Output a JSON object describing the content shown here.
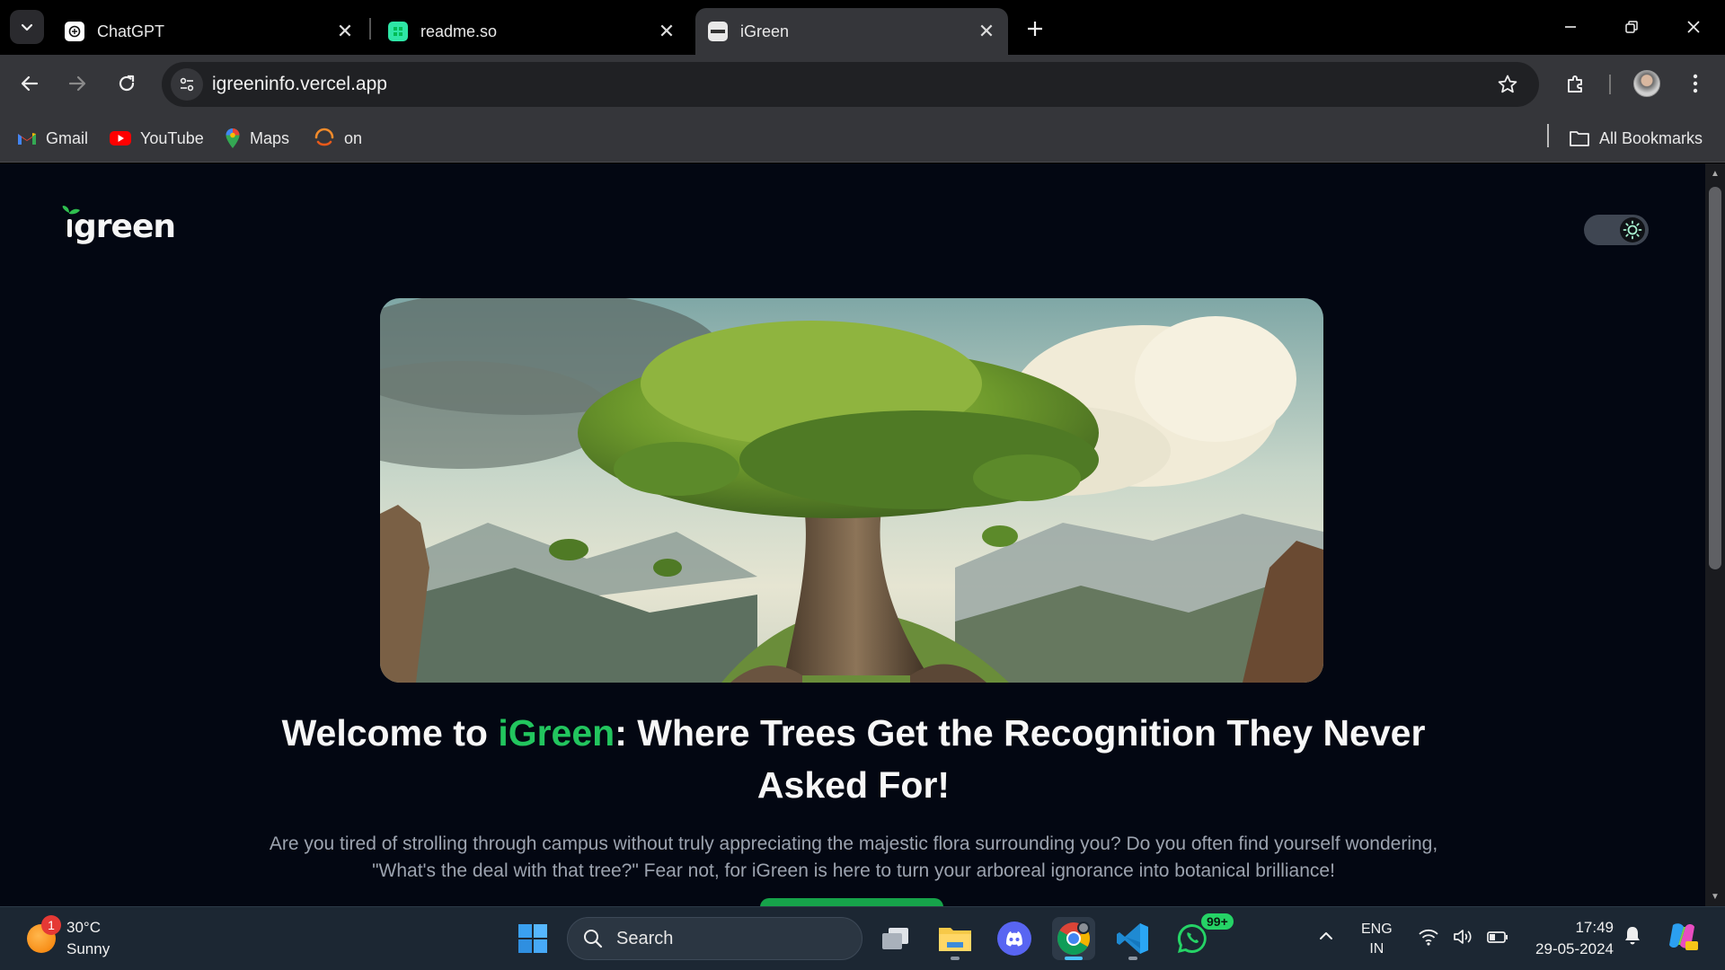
{
  "browser": {
    "tabs": [
      {
        "title": "ChatGPT",
        "active": false
      },
      {
        "title": "readme.so",
        "active": false
      },
      {
        "title": "iGreen",
        "active": true
      }
    ],
    "url": "igreeninfo.vercel.app",
    "bookmarks": [
      {
        "label": "Gmail",
        "icon": "gmail-icon"
      },
      {
        "label": "YouTube",
        "icon": "youtube-icon"
      },
      {
        "label": "Maps",
        "icon": "maps-icon"
      },
      {
        "label": "on",
        "icon": "orange-arc-icon"
      }
    ],
    "all_bookmarks_label": "All Bookmarks"
  },
  "page": {
    "logo_text": "green",
    "headline_prefix": "Welcome to ",
    "headline_brand": "iGreen",
    "headline_suffix": ": Where Trees Get the Recognition They Never Asked For!",
    "lead": "Are you tired of strolling through campus without truly appreciating the majestic flora surrounding you? Do you often find yourself wondering, \"What's the deal with that tree?\" Fear not, for iGreen is here to turn your arboreal ignorance into botanical brilliance!",
    "accent_color": "#22c55e",
    "background_color": "#030712"
  },
  "taskbar": {
    "weather_badge": "1",
    "temperature": "30°C",
    "condition": "Sunny",
    "search_label": "Search",
    "whatsapp_badge": "99+",
    "language_line1": "ENG",
    "language_line2": "IN",
    "time": "17:49",
    "date": "29-05-2024"
  }
}
